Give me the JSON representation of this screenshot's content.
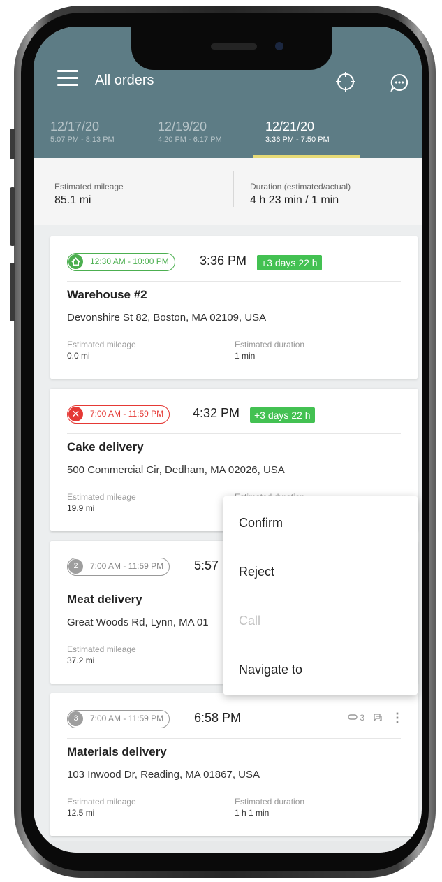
{
  "header": {
    "title": "All orders",
    "background": "#5d7c85",
    "date_tabs": [
      {
        "date": "12/17/20",
        "time_range": "5:07 PM - 8:13 PM"
      },
      {
        "date": "12/19/20",
        "time_range": "4:20 PM - 6:17 PM"
      },
      {
        "date": "12/21/20",
        "time_range": "3:36 PM - 7:50 PM"
      }
    ],
    "selected_tab_index": 2
  },
  "summary": {
    "mileage_label": "Estimated mileage",
    "mileage_value": "85.1 mi",
    "duration_label": "Duration (estimated/actual)",
    "duration_value": "4 h 23 min / 1 min"
  },
  "orders": [
    {
      "status_icon": "home-icon",
      "window": "12:30 AM - 10:00 PM",
      "eta": "3:36 PM",
      "badge": "+3 days 22 h",
      "title": "Warehouse #2",
      "address": "Devonshire St 82, Boston, MA 02109, USA",
      "mileage_label": "Estimated mileage",
      "mileage": "0.0 mi",
      "duration_label": "Estimated duration",
      "duration": "1 min"
    },
    {
      "status_icon": "rejected-x-icon",
      "window": "7:00 AM - 11:59 PM",
      "eta": "4:32 PM",
      "badge": "+3 days 22 h",
      "title": "Cake delivery",
      "address": "500 Commercial Cir, Dedham, MA 02026, USA",
      "mileage_label": "Estimated mileage",
      "mileage": "19.9 mi",
      "duration_label": "Estimated duration"
    },
    {
      "stop_number": "2",
      "window": "7:00 AM - 11:59 PM",
      "eta": "5:57",
      "title": "Meat delivery",
      "address": "Great Woods Rd, Lynn, MA 01",
      "mileage_label": "Estimated mileage",
      "mileage": "37.2 mi"
    },
    {
      "stop_number": "3",
      "window": "7:00 AM - 11:59 PM",
      "eta": "6:58 PM",
      "attachments_count": "3",
      "title": "Materials delivery",
      "address": "103 Inwood Dr, Reading, MA 01867, USA",
      "mileage_label": "Estimated mileage",
      "mileage": "12.5 mi",
      "duration_label": "Estimated duration",
      "duration": "1 h 1 min"
    }
  ],
  "context_menu": {
    "items": [
      {
        "label": "Confirm",
        "enabled": true
      },
      {
        "label": "Reject",
        "enabled": true
      },
      {
        "label": "Call",
        "enabled": false
      },
      {
        "label": "Navigate to",
        "enabled": true
      }
    ]
  },
  "colors": {
    "accent_green": "#43c152",
    "reject_red": "#e53935",
    "tab_underline": "#e6da76"
  }
}
